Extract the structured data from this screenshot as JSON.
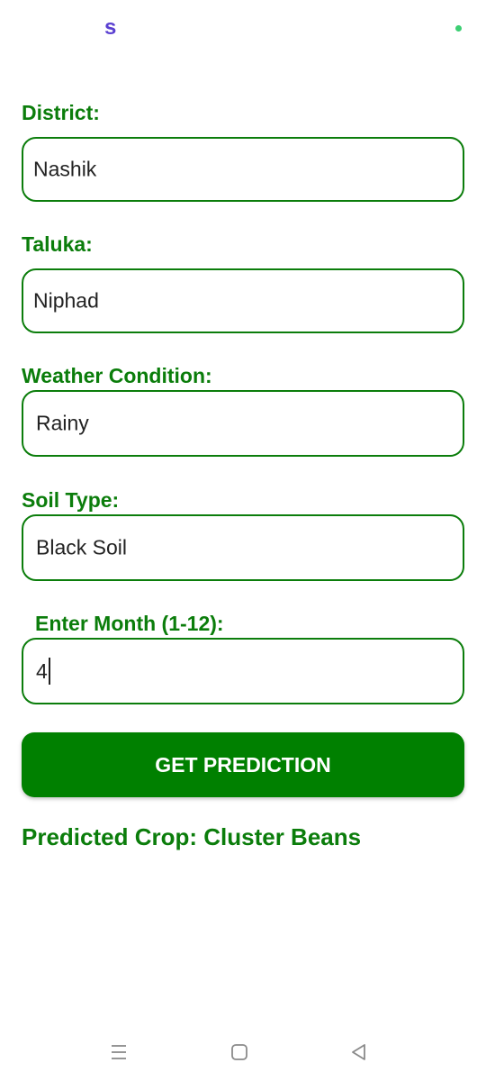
{
  "status_bar": {
    "app_icon_glyph": "s",
    "app_icon_color": "#5a3fd1",
    "dot_color": "#3ccf73"
  },
  "form": {
    "district": {
      "label": "District:",
      "value": "Nashik"
    },
    "taluka": {
      "label": "Taluka:",
      "value": "Niphad"
    },
    "weather": {
      "label": "Weather Condition:",
      "value": "Rainy"
    },
    "soil": {
      "label": "Soil Type:",
      "value": "Black Soil"
    },
    "month": {
      "label": "Enter Month (1-12):",
      "value": "4"
    }
  },
  "button": {
    "label": "GET PREDICTION"
  },
  "result": {
    "text": "Predicted Crop: Cluster Beans"
  },
  "nav_bar": {
    "icons": [
      "menu-icon",
      "home-square-icon",
      "back-triangle-icon"
    ]
  },
  "colors": {
    "accent_green": "#0b7d0b",
    "button_green": "#008000",
    "background": "#ffffff"
  }
}
